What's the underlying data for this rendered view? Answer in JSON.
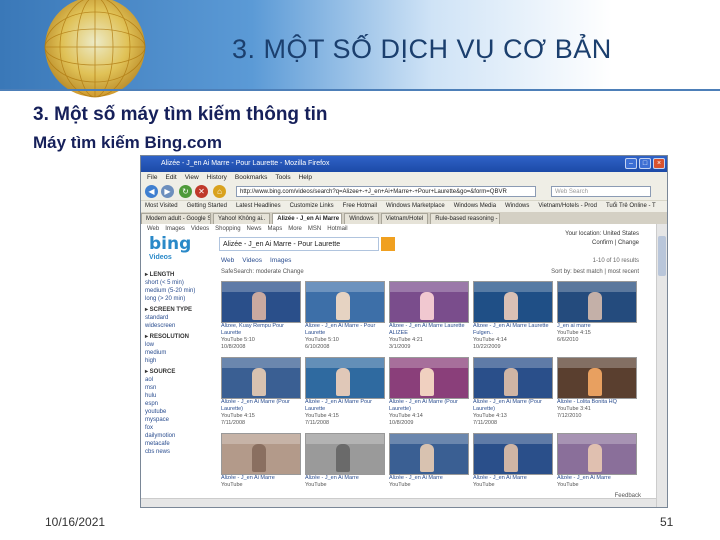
{
  "slide": {
    "title": "3. MỘT SỐ DỊCH VỤ CƠ BẢN",
    "heading": "3. Một số máy tìm kiếm thông tin",
    "subheading": "Máy tìm kiếm Bing.com",
    "date": "10/16/2021",
    "page_number": "51"
  },
  "browser": {
    "window_title": "Alizée - J_en Ai Marre - Pour Laurette - Mozilla Firefox",
    "menu": [
      "File",
      "Edit",
      "View",
      "History",
      "Bookmarks",
      "Tools",
      "Help"
    ],
    "url": "http://www.bing.com/videos/search?q=Alizee+-+J_en+Ai+Marre+-+Pour+Laurette&go=&form=QBVR",
    "search_placeholder": "Web Search",
    "bookmarks": [
      "Most Visited",
      "Getting Started",
      "Latest Headlines",
      "Customize Links",
      "Free Hotmail",
      "Windows Marketplace",
      "Windows Media",
      "Windows",
      "Vietnam/Hotels - Prod",
      "Tuổi Trẻ Online - T"
    ],
    "tabs": [
      "Modern adult - Google Search",
      "Yahoo! Không ai..",
      "Alizée - J_en Ai Marre",
      "Windows",
      "Vietnam/Hotel",
      "Rule-based reasoning - Wikipedia"
    ],
    "active_tab_index": 2
  },
  "bing": {
    "top_links": [
      "Web",
      "Images",
      "Videos",
      "Shopping",
      "News",
      "Maps",
      "More",
      "MSN",
      "Hotmail"
    ],
    "logo": "bing",
    "query": "Alizée - J_en Ai Marre - Pour Laurette",
    "location_label": "Your location: United States",
    "location_links": [
      "Confirm",
      "Change"
    ],
    "section": "Videos",
    "subnav": [
      "Web",
      "Videos",
      "Images"
    ],
    "result_count": "1-10 of 10 results",
    "safesearch": "SafeSearch: moderate  Change",
    "sort": "Sort by: best match | most recent",
    "sidebar": [
      {
        "type": "sec",
        "text": "▸ LENGTH"
      },
      {
        "type": "item",
        "text": "short (< 5 min)"
      },
      {
        "type": "item",
        "text": "medium (5-20 min)"
      },
      {
        "type": "item",
        "text": "long (> 20 min)"
      },
      {
        "type": "sec",
        "text": "▸ SCREEN TYPE"
      },
      {
        "type": "item",
        "text": "standard"
      },
      {
        "type": "item",
        "text": "widescreen"
      },
      {
        "type": "sec",
        "text": "▸ RESOLUTION"
      },
      {
        "type": "item",
        "text": "low"
      },
      {
        "type": "item",
        "text": "medium"
      },
      {
        "type": "item",
        "text": "high"
      },
      {
        "type": "sec",
        "text": "▸ SOURCE"
      },
      {
        "type": "item",
        "text": "aol"
      },
      {
        "type": "item",
        "text": "msn"
      },
      {
        "type": "item",
        "text": "hulu"
      },
      {
        "type": "item",
        "text": "espn"
      },
      {
        "type": "item",
        "text": "youtube"
      },
      {
        "type": "item",
        "text": "myspace"
      },
      {
        "type": "item",
        "text": "fox"
      },
      {
        "type": "item",
        "text": "dailymotion"
      },
      {
        "type": "item",
        "text": "metacafe"
      },
      {
        "type": "item",
        "text": "cbs news"
      }
    ],
    "videos": [
      [
        {
          "title": "Alizee, Kuay Rempu Pour Laurette",
          "source": "YouTube  5:10",
          "date": "10/8/2008",
          "color": "#2a4f8a",
          "fig": "#c9a9a0"
        },
        {
          "title": "Alizee - J_en Ai Marre - Pour Laurette",
          "source": "YouTube  5:10",
          "date": "6/10/2008",
          "color": "#3d6fa8",
          "fig": "#e6d3c2"
        },
        {
          "title": "Alizee - J_en Ai Marre Laurette ALIZEE",
          "source": "YouTube  4:21",
          "date": "3/1/2009",
          "color": "#7a4d8c",
          "fig": "#f1c8d0"
        },
        {
          "title": "Alizee - J_en Ai Marre Laurette Fulgen..",
          "source": "YouTube  4:14",
          "date": "10/22/2009",
          "color": "#1f4f86",
          "fig": "#d9c0b5"
        },
        {
          "title": "J_en ai marre",
          "source": "YouTube  4:15",
          "date": "6/6/2010",
          "color": "#244b7d",
          "fig": "#c4b0a8"
        }
      ],
      [
        {
          "title": "Alizée - J_en Ai Marre (Pour Laurette)",
          "source": "YouTube  4:15",
          "date": "7/11/2008",
          "color": "#3a5f93",
          "fig": "#d8c2b0"
        },
        {
          "title": "Alizée - J_en Ai Marre Pour Laurette",
          "source": "YouTube  4:15",
          "date": "7/11/2008",
          "color": "#2f6aa0",
          "fig": "#e0c8b8"
        },
        {
          "title": "Alizée - J_en Ai Marre (Pour Laurette)",
          "source": "YouTube  4:14",
          "date": "10/8/2009",
          "color": "#8a3f7a",
          "fig": "#f0d0c0"
        },
        {
          "title": "Alizée - J_en Ai Marre (Pour Laurette)",
          "source": "YouTube  4:13",
          "date": "7/11/2008",
          "color": "#2a4f8a",
          "fig": "#cfb5a5"
        },
        {
          "title": "Alizée - Lolita Bonita HQ",
          "source": "YouTube  3:41",
          "date": "7/12/2010",
          "color": "#5a3f2f",
          "fig": "#e8a060"
        }
      ],
      [
        {
          "title": "Alizée - J_en Ai Marre",
          "source": "YouTube",
          "date": "",
          "color": "#b39a8a",
          "fig": "#8a6f60"
        },
        {
          "title": "Alizée - J_en Ai Marre",
          "source": "YouTube",
          "date": "",
          "color": "#9a9a9a",
          "fig": "#6a6a6a"
        },
        {
          "title": "Alizée - J_en Ai Marre",
          "source": "YouTube",
          "date": "",
          "color": "#3a5f93",
          "fig": "#d8c2b0"
        },
        {
          "title": "Alizée - J_en Ai Marre",
          "source": "YouTube",
          "date": "",
          "color": "#2a4f8a",
          "fig": "#cfb5a5"
        },
        {
          "title": "Alizée - J_en Ai Marre",
          "source": "YouTube",
          "date": "",
          "color": "#8a6f9a",
          "fig": "#e0c0b0"
        }
      ]
    ],
    "feedback": "Feedback"
  },
  "colors": {
    "banner": "#3a78b8",
    "title_text": "#1b3f6e",
    "heading_text": "#16205a",
    "bing_blue": "#2a89c8"
  }
}
